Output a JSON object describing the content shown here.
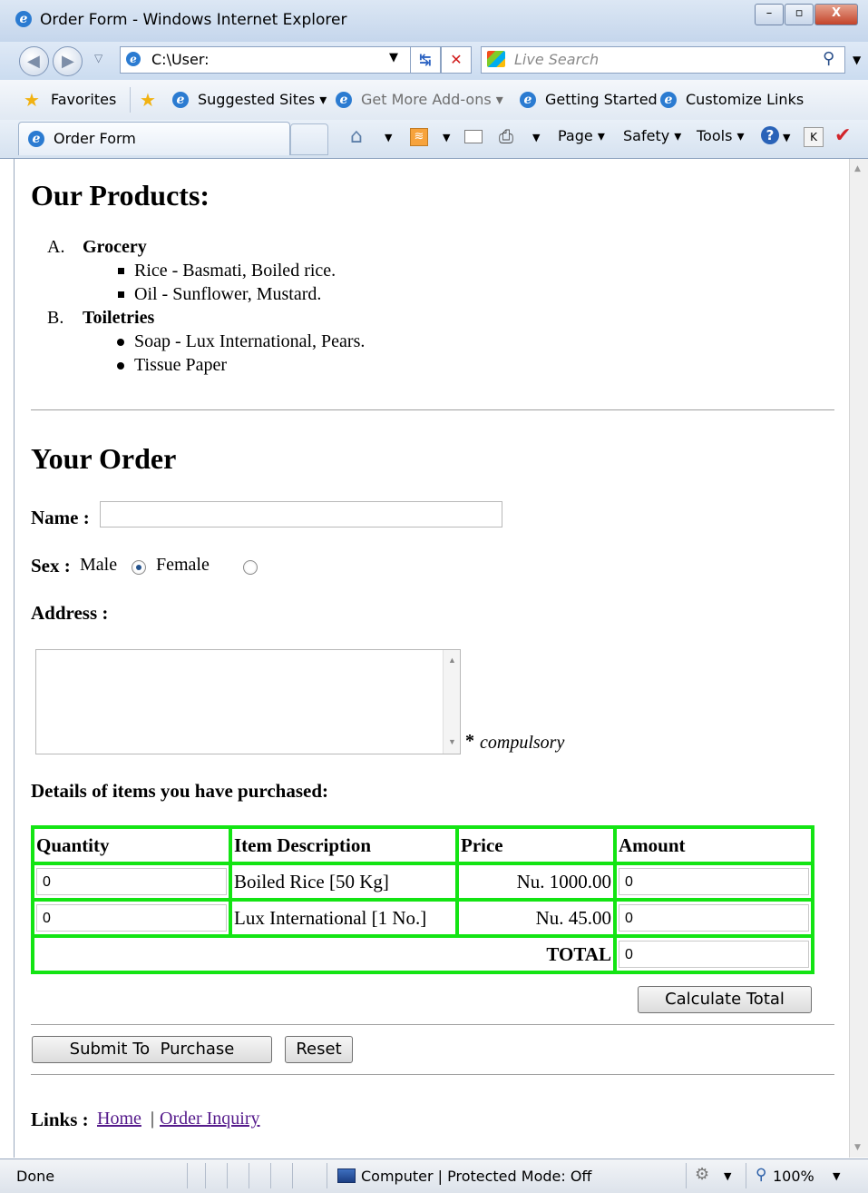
{
  "window": {
    "title": "Order Form - Windows Internet Explorer",
    "minimize": "–",
    "maximize": "▫",
    "close": "X"
  },
  "navbar": {
    "address": "C:\\User:",
    "search_placeholder": "Live Search"
  },
  "favorites_bar": {
    "favorites": "Favorites",
    "links": [
      "Suggested Sites ▾",
      "Get More Add-ons ▾",
      "Getting Started",
      "Customize Links"
    ]
  },
  "tabbar": {
    "tab_title": "Order Form",
    "tools": [
      "Page ▾",
      "Safety ▾",
      "Tools ▾"
    ]
  },
  "page": {
    "products_heading": "Our Products:",
    "categories": [
      {
        "marker": "A.",
        "name": "Grocery",
        "items": [
          "Rice - Basmati, Boiled rice.",
          "Oil - Sunflower, Mustard."
        ]
      },
      {
        "marker": "B.",
        "name": "Toiletries",
        "items": [
          "Soap - Lux International, Pears.",
          "Tissue Paper"
        ]
      }
    ],
    "order_heading": "Your Order",
    "name_label": "Name :",
    "name_value": "",
    "sex_label": "Sex :",
    "male_label": "Male",
    "female_label": "Female",
    "selected_sex": "Male",
    "address_label": "Address :",
    "compulsory_star": "*",
    "compulsory_text": "compulsory",
    "details_label": "Details of items you have purchased:",
    "table": {
      "headers": [
        "Quantity",
        "Item Description",
        "Price",
        "Amount"
      ],
      "rows": [
        {
          "quantity": "0",
          "description": "Boiled Rice [50 Kg]",
          "price": "Nu. 1000.00",
          "amount": "0"
        },
        {
          "quantity": "0",
          "description": "Lux International [1 No.]",
          "price": "Nu. 45.00",
          "amount": "0"
        }
      ],
      "total_label": "TOTAL",
      "total_value": "0"
    },
    "calculate_button": "Calculate Total",
    "submit_button": "Submit To  Purchase",
    "reset_button": "Reset",
    "links_label": "Links :",
    "link_home": "Home",
    "link_separator": "|",
    "link_inquiry": "Order Inquiry"
  },
  "status": {
    "text": "Done",
    "zone": "Computer | Protected Mode: Off",
    "zoom": "100%"
  }
}
